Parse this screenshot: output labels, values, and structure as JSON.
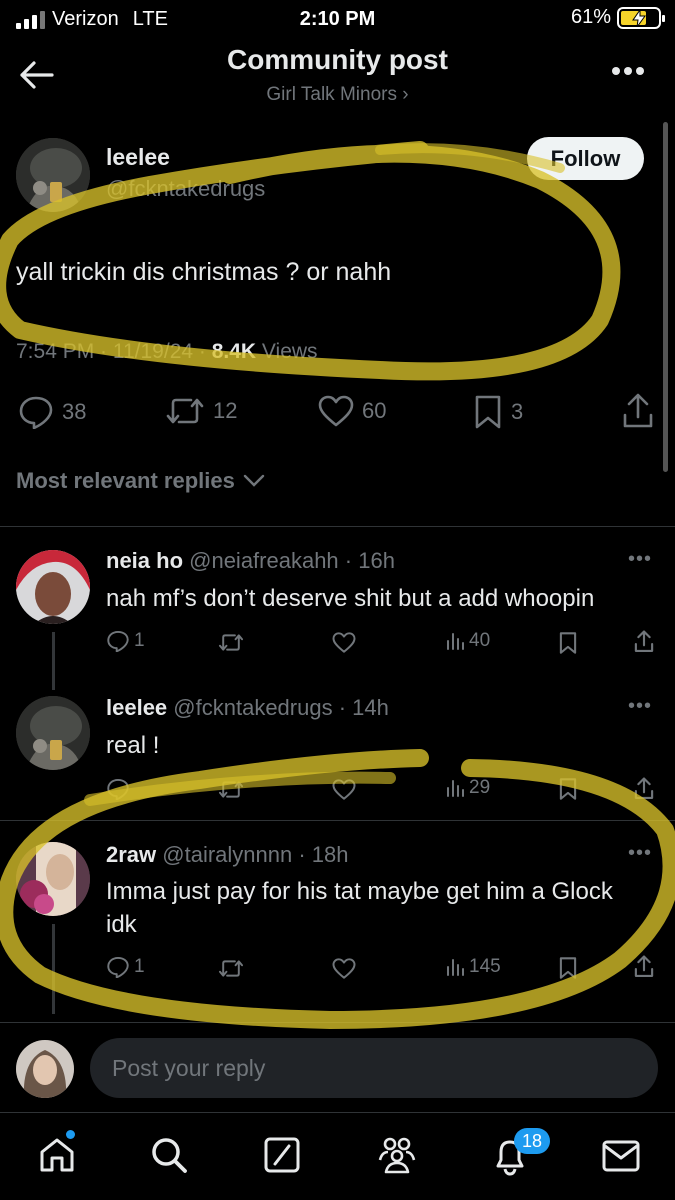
{
  "status": {
    "carrier": "Verizon",
    "network": "LTE",
    "time": "2:10 PM",
    "battery": "61%",
    "battery_color": "#f5d32a"
  },
  "header": {
    "title": "Community post",
    "community": "Girl Talk Minors ›"
  },
  "post": {
    "name": "leelee",
    "handle": "@fckntakedrugs",
    "follow_label": "Follow",
    "text": "yall trickin dis christmas ? or nahh",
    "time": "7:54 PM · 11/19/24 · ",
    "views_count": "8.4K",
    "views_label": " Views",
    "actions": {
      "replies": "38",
      "reposts": "12",
      "likes": "60",
      "bookmarks": "3"
    }
  },
  "sort_label": "Most relevant replies",
  "replies": [
    {
      "name": "neia ho",
      "meta": " @neiafreakahh · 16h",
      "text": "nah mf’s don’t deserve shit but a add whoopin",
      "replies": "1",
      "views": "40"
    },
    {
      "name": "leelee",
      "meta": " @fckntakedrugs · 14h",
      "text": "real !",
      "replies": "",
      "views": "29"
    },
    {
      "name": "2raw",
      "meta": " @tairalynnnn · 18h",
      "text_line1": "Imma just pay for his tat maybe get him a Glock",
      "text_line2": "idk",
      "replies": "1",
      "views": "145"
    }
  ],
  "reply_placeholder": "Post your reply",
  "tabs": {
    "notifications_badge": "18"
  },
  "colors": {
    "accent": "#1d9bf0",
    "highlight": "#d8c22a",
    "background": "#000000"
  },
  "icons": [
    "back-arrow-icon",
    "more-icon",
    "reply-icon",
    "repost-icon",
    "like-icon",
    "bookmark-icon",
    "share-icon",
    "views-icon",
    "home-icon",
    "search-icon",
    "grok-icon",
    "communities-icon",
    "bell-icon",
    "mail-icon",
    "chevron-down-icon"
  ]
}
